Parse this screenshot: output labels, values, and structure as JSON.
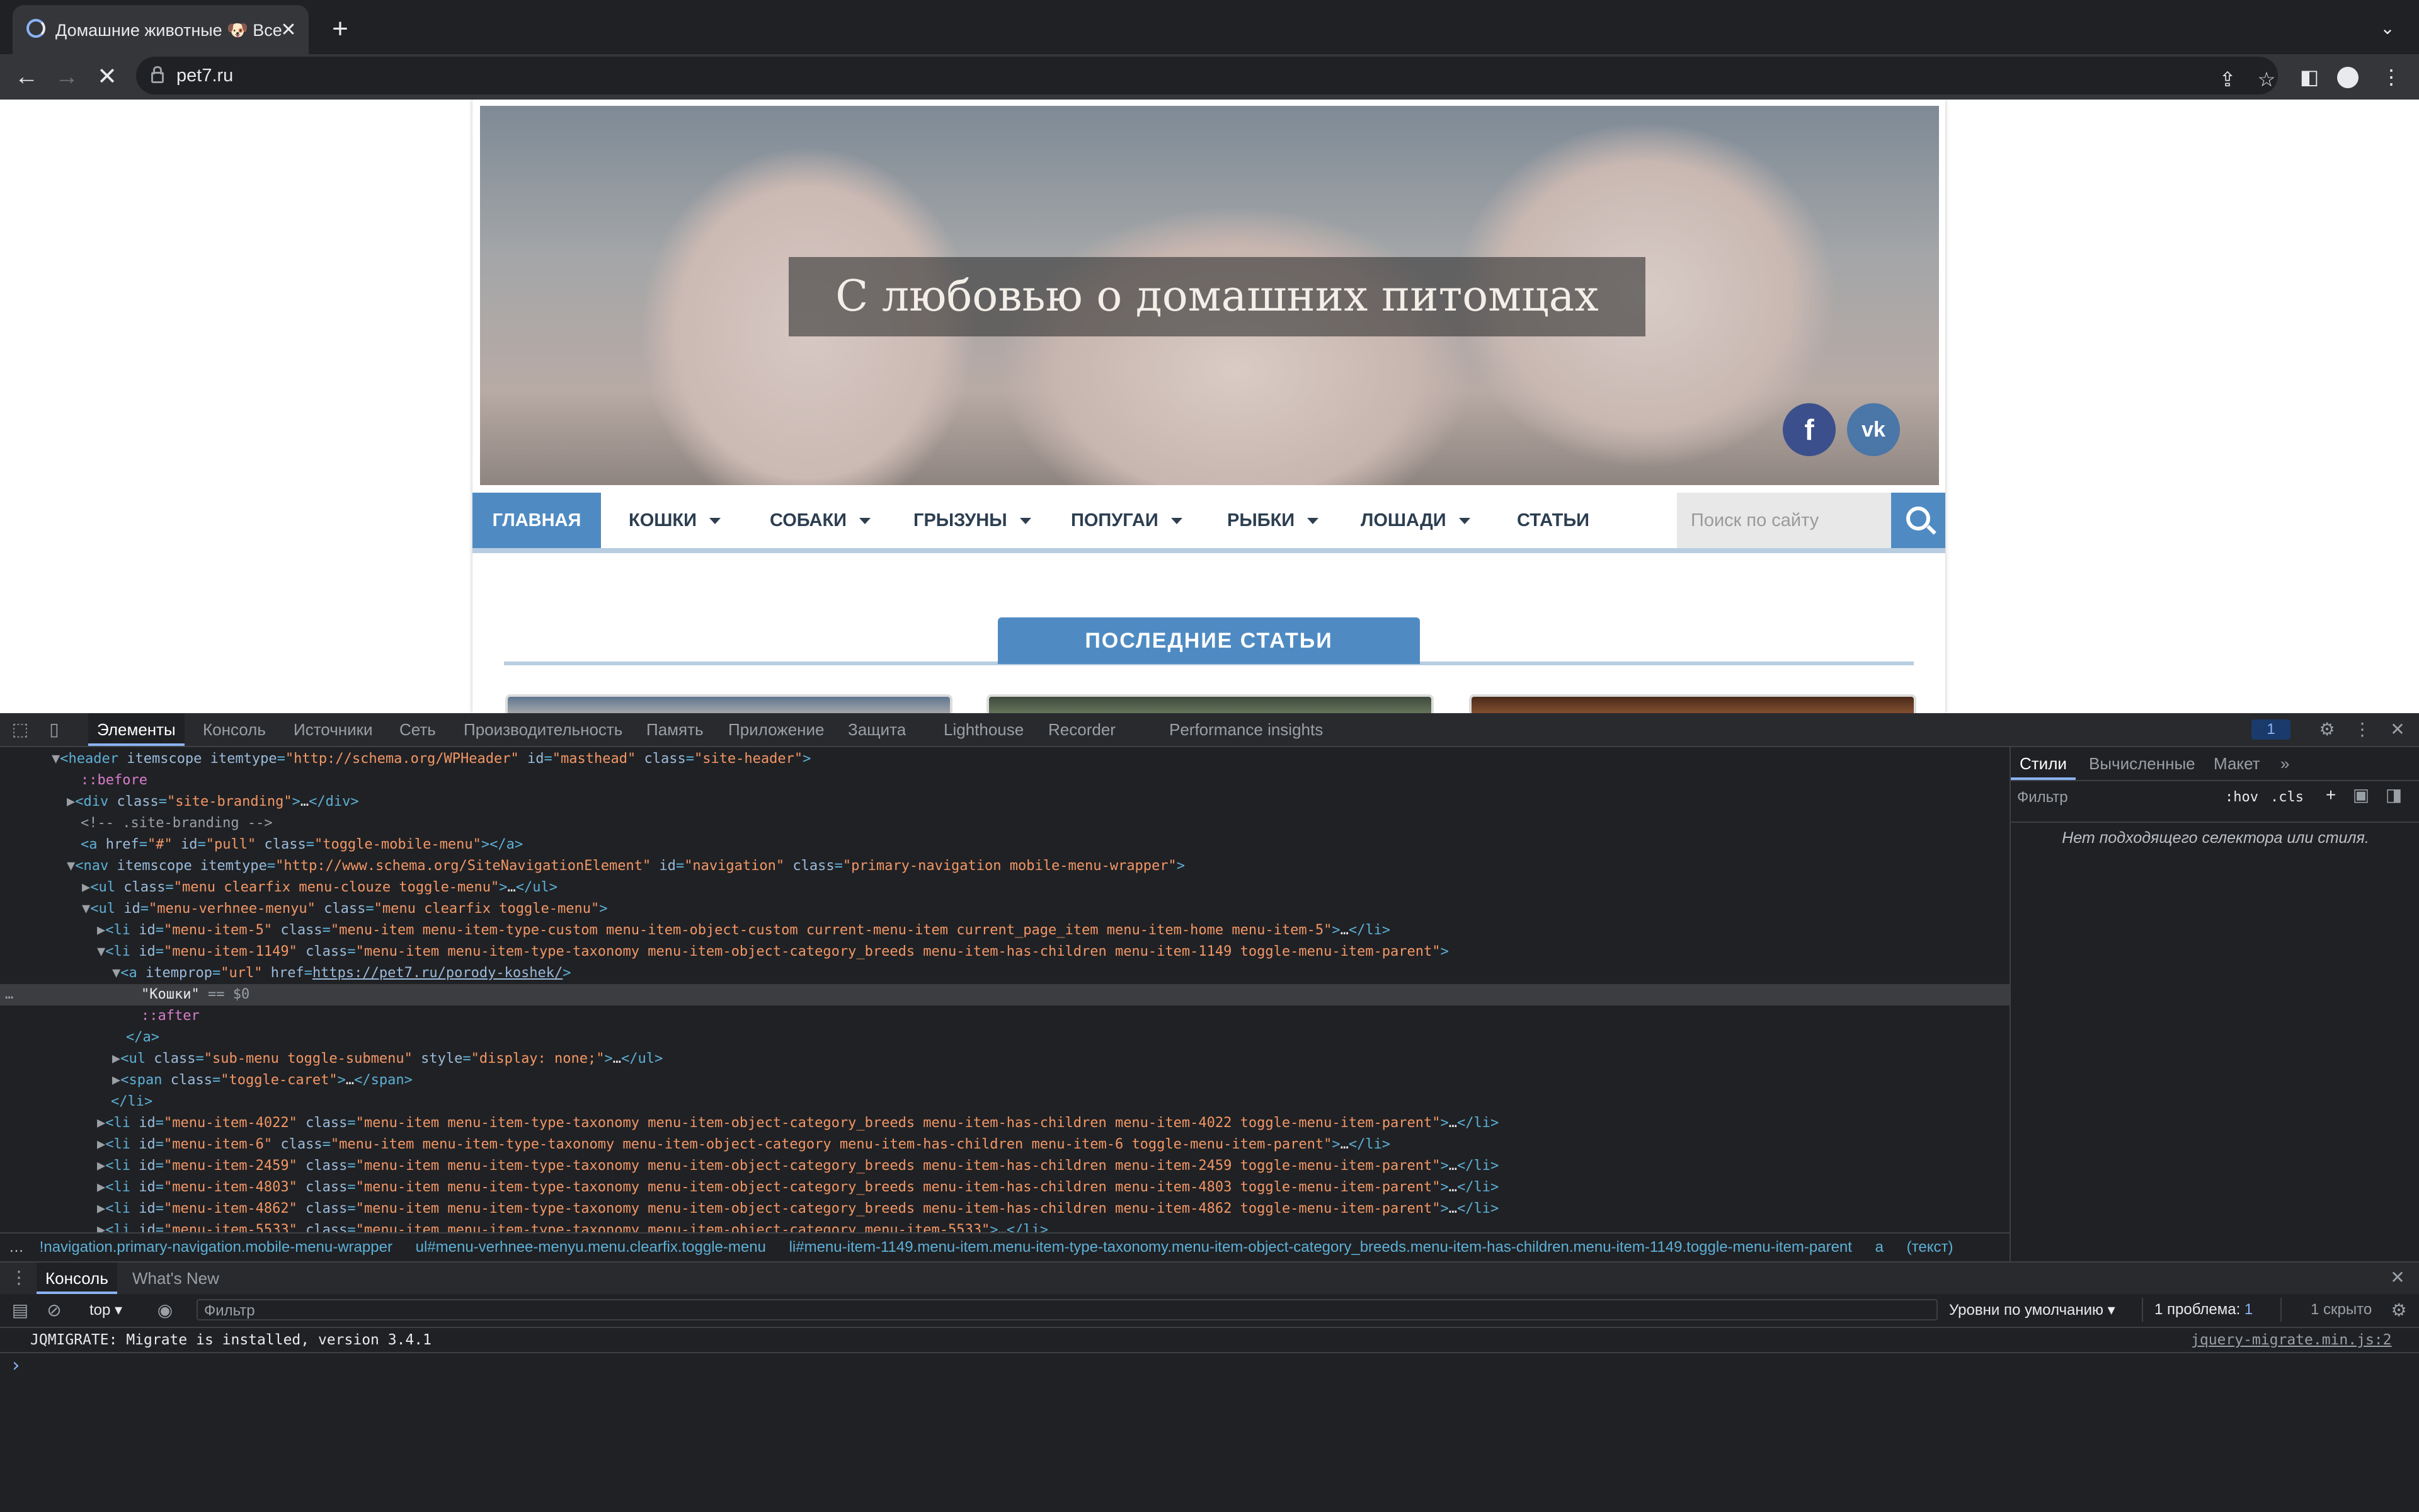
{
  "browser": {
    "tab_title": "Домашние животные 🐶 Все о",
    "close_tab": "✕",
    "new_tab": "+",
    "url": "pet7.ru",
    "back": "←",
    "forward": "→",
    "stop": "✕"
  },
  "site": {
    "hero_title": "С любовью о домашних питомцах",
    "social": {
      "facebook": "f",
      "vk": "vk"
    },
    "nav": {
      "home": "ГЛАВНАЯ",
      "items": [
        "КОШКИ",
        "СОБАКИ",
        "ГРЫЗУНЫ",
        "ПОПУГАИ",
        "РЫБКИ",
        "ЛОШАДИ",
        "СТАТЬИ"
      ]
    },
    "search_placeholder": "Поиск по сайту",
    "latest_heading": "ПОСЛЕДНИЕ СТАТЬИ",
    "colors": {
      "accent": "#4f8bc2",
      "nav_underline": "#b8cde0"
    }
  },
  "devtools": {
    "tabs": [
      "Элементы",
      "Консоль",
      "Источники",
      "Сеть",
      "Производительность",
      "Память",
      "Приложение",
      "Защита",
      "Lighthouse",
      "Recorder",
      "Performance insights"
    ],
    "issues_count": "1",
    "dom_lines": [
      {
        "indent": 0,
        "parts": [
          [
            "tri",
            "▼"
          ],
          [
            "tag",
            "<header "
          ],
          [
            "attr",
            "itemscope itemtype"
          ],
          [
            "tag",
            "="
          ],
          [
            "val",
            "\"http://schema.org/WPHeader\""
          ],
          [
            "attr",
            " id"
          ],
          [
            "tag",
            "="
          ],
          [
            "val",
            "\"masthead\""
          ],
          [
            "attr",
            " class"
          ],
          [
            "tag",
            "="
          ],
          [
            "val",
            "\"site-header\""
          ],
          [
            "tag",
            ">"
          ]
        ]
      },
      {
        "indent": 1,
        "parts": [
          [
            "pseudo",
            "::before"
          ]
        ]
      },
      {
        "indent": 1,
        "parts": [
          [
            "tri",
            "▶"
          ],
          [
            "tag",
            "<div "
          ],
          [
            "attr",
            "class"
          ],
          [
            "tag",
            "="
          ],
          [
            "val",
            "\"site-branding\""
          ],
          [
            "tag",
            ">"
          ],
          [
            "txt",
            "…"
          ],
          [
            "tag",
            "</div>"
          ]
        ]
      },
      {
        "indent": 1,
        "parts": [
          [
            "cmt",
            "<!-- .site-branding -->"
          ]
        ]
      },
      {
        "indent": 1,
        "parts": [
          [
            "tag",
            "<a "
          ],
          [
            "attr",
            "href"
          ],
          [
            "tag",
            "="
          ],
          [
            "val",
            "\"#\""
          ],
          [
            "attr",
            " id"
          ],
          [
            "tag",
            "="
          ],
          [
            "val",
            "\"pull\""
          ],
          [
            "attr",
            " class"
          ],
          [
            "tag",
            "="
          ],
          [
            "val",
            "\"toggle-mobile-menu\""
          ],
          [
            "tag",
            "></a>"
          ]
        ]
      },
      {
        "indent": 1,
        "parts": [
          [
            "tri",
            "▼"
          ],
          [
            "tag",
            "<nav "
          ],
          [
            "attr",
            "itemscope itemtype"
          ],
          [
            "tag",
            "="
          ],
          [
            "val",
            "\"http://www.schema.org/SiteNavigationElement\""
          ],
          [
            "attr",
            " id"
          ],
          [
            "tag",
            "="
          ],
          [
            "val",
            "\"navigation\""
          ],
          [
            "attr",
            " class"
          ],
          [
            "tag",
            "="
          ],
          [
            "val",
            "\"primary-navigation mobile-menu-wrapper\""
          ],
          [
            "tag",
            ">"
          ]
        ]
      },
      {
        "indent": 2,
        "parts": [
          [
            "tri",
            "▶"
          ],
          [
            "tag",
            "<ul "
          ],
          [
            "attr",
            "class"
          ],
          [
            "tag",
            "="
          ],
          [
            "val",
            "\"menu clearfix menu-clouze toggle-menu\""
          ],
          [
            "tag",
            ">"
          ],
          [
            "txt",
            "…"
          ],
          [
            "tag",
            "</ul>"
          ]
        ]
      },
      {
        "indent": 2,
        "parts": [
          [
            "tri",
            "▼"
          ],
          [
            "tag",
            "<ul "
          ],
          [
            "attr",
            "id"
          ],
          [
            "tag",
            "="
          ],
          [
            "val",
            "\"menu-verhnee-menyu\""
          ],
          [
            "attr",
            " class"
          ],
          [
            "tag",
            "="
          ],
          [
            "val",
            "\"menu clearfix toggle-menu\""
          ],
          [
            "tag",
            ">"
          ]
        ]
      },
      {
        "indent": 3,
        "parts": [
          [
            "tri",
            "▶"
          ],
          [
            "tag",
            "<li "
          ],
          [
            "attr",
            "id"
          ],
          [
            "tag",
            "="
          ],
          [
            "val",
            "\"menu-item-5\""
          ],
          [
            "attr",
            " class"
          ],
          [
            "tag",
            "="
          ],
          [
            "val",
            "\"menu-item menu-item-type-custom menu-item-object-custom current-menu-item current_page_item menu-item-home menu-item-5\""
          ],
          [
            "tag",
            ">"
          ],
          [
            "txt",
            "…"
          ],
          [
            "tag",
            "</li>"
          ]
        ]
      },
      {
        "indent": 3,
        "parts": [
          [
            "tri",
            "▼"
          ],
          [
            "tag",
            "<li "
          ],
          [
            "attr",
            "id"
          ],
          [
            "tag",
            "="
          ],
          [
            "val",
            "\"menu-item-1149\""
          ],
          [
            "attr",
            " class"
          ],
          [
            "tag",
            "="
          ],
          [
            "val",
            "\"menu-item menu-item-type-taxonomy menu-item-object-category_breeds menu-item-has-children menu-item-1149 toggle-menu-item-parent\""
          ],
          [
            "tag",
            ">"
          ]
        ]
      },
      {
        "indent": 4,
        "parts": [
          [
            "tri",
            "▼"
          ],
          [
            "tag",
            "<a "
          ],
          [
            "attr",
            "itemprop"
          ],
          [
            "tag",
            "="
          ],
          [
            "val",
            "\"url\""
          ],
          [
            "attr",
            " href"
          ],
          [
            "tag",
            "="
          ],
          [
            "link",
            "https://pet7.ru/porody-koshek/"
          ],
          [
            "tag",
            ">"
          ]
        ]
      },
      {
        "indent": 5,
        "sel": true,
        "parts": [
          [
            "txt",
            "\"Кошки\""
          ],
          [
            "cmt",
            " == $0"
          ]
        ]
      },
      {
        "indent": 5,
        "parts": [
          [
            "pseudo",
            "::after"
          ]
        ]
      },
      {
        "indent": 4,
        "parts": [
          [
            "tag",
            "</a>"
          ]
        ]
      },
      {
        "indent": 4,
        "parts": [
          [
            "tri",
            "▶"
          ],
          [
            "tag",
            "<ul "
          ],
          [
            "attr",
            "class"
          ],
          [
            "tag",
            "="
          ],
          [
            "val",
            "\"sub-menu toggle-submenu\""
          ],
          [
            "attr",
            " style"
          ],
          [
            "tag",
            "="
          ],
          [
            "val",
            "\"display: none;\""
          ],
          [
            "tag",
            ">"
          ],
          [
            "txt",
            "…"
          ],
          [
            "tag",
            "</ul>"
          ]
        ]
      },
      {
        "indent": 4,
        "parts": [
          [
            "tri",
            "▶"
          ],
          [
            "tag",
            "<span "
          ],
          [
            "attr",
            "class"
          ],
          [
            "tag",
            "="
          ],
          [
            "val",
            "\"toggle-caret\""
          ],
          [
            "tag",
            ">"
          ],
          [
            "txt",
            "…"
          ],
          [
            "tag",
            "</span>"
          ]
        ]
      },
      {
        "indent": 3,
        "parts": [
          [
            "tag",
            "</li>"
          ]
        ]
      },
      {
        "indent": 3,
        "parts": [
          [
            "tri",
            "▶"
          ],
          [
            "tag",
            "<li "
          ],
          [
            "attr",
            "id"
          ],
          [
            "tag",
            "="
          ],
          [
            "val",
            "\"menu-item-4022\""
          ],
          [
            "attr",
            " class"
          ],
          [
            "tag",
            "="
          ],
          [
            "val",
            "\"menu-item menu-item-type-taxonomy menu-item-object-category_breeds menu-item-has-children menu-item-4022 toggle-menu-item-parent\""
          ],
          [
            "tag",
            ">"
          ],
          [
            "txt",
            "…"
          ],
          [
            "tag",
            "</li>"
          ]
        ]
      },
      {
        "indent": 3,
        "parts": [
          [
            "tri",
            "▶"
          ],
          [
            "tag",
            "<li "
          ],
          [
            "attr",
            "id"
          ],
          [
            "tag",
            "="
          ],
          [
            "val",
            "\"menu-item-6\""
          ],
          [
            "attr",
            " class"
          ],
          [
            "tag",
            "="
          ],
          [
            "val",
            "\"menu-item menu-item-type-taxonomy menu-item-object-category menu-item-has-children menu-item-6 toggle-menu-item-parent\""
          ],
          [
            "tag",
            ">"
          ],
          [
            "txt",
            "…"
          ],
          [
            "tag",
            "</li>"
          ]
        ]
      },
      {
        "indent": 3,
        "parts": [
          [
            "tri",
            "▶"
          ],
          [
            "tag",
            "<li "
          ],
          [
            "attr",
            "id"
          ],
          [
            "tag",
            "="
          ],
          [
            "val",
            "\"menu-item-2459\""
          ],
          [
            "attr",
            " class"
          ],
          [
            "tag",
            "="
          ],
          [
            "val",
            "\"menu-item menu-item-type-taxonomy menu-item-object-category_breeds menu-item-has-children menu-item-2459 toggle-menu-item-parent\""
          ],
          [
            "tag",
            ">"
          ],
          [
            "txt",
            "…"
          ],
          [
            "tag",
            "</li>"
          ]
        ]
      },
      {
        "indent": 3,
        "parts": [
          [
            "tri",
            "▶"
          ],
          [
            "tag",
            "<li "
          ],
          [
            "attr",
            "id"
          ],
          [
            "tag",
            "="
          ],
          [
            "val",
            "\"menu-item-4803\""
          ],
          [
            "attr",
            " class"
          ],
          [
            "tag",
            "="
          ],
          [
            "val",
            "\"menu-item menu-item-type-taxonomy menu-item-object-category_breeds menu-item-has-children menu-item-4803 toggle-menu-item-parent\""
          ],
          [
            "tag",
            ">"
          ],
          [
            "txt",
            "…"
          ],
          [
            "tag",
            "</li>"
          ]
        ]
      },
      {
        "indent": 3,
        "parts": [
          [
            "tri",
            "▶"
          ],
          [
            "tag",
            "<li "
          ],
          [
            "attr",
            "id"
          ],
          [
            "tag",
            "="
          ],
          [
            "val",
            "\"menu-item-4862\""
          ],
          [
            "attr",
            " class"
          ],
          [
            "tag",
            "="
          ],
          [
            "val",
            "\"menu-item menu-item-type-taxonomy menu-item-object-category_breeds menu-item-has-children menu-item-4862 toggle-menu-item-parent\""
          ],
          [
            "tag",
            ">"
          ],
          [
            "txt",
            "…"
          ],
          [
            "tag",
            "</li>"
          ]
        ]
      },
      {
        "indent": 3,
        "parts": [
          [
            "tri",
            "▶"
          ],
          [
            "tag",
            "<li "
          ],
          [
            "attr",
            "id"
          ],
          [
            "tag",
            "="
          ],
          [
            "val",
            "\"menu-item-5533\""
          ],
          [
            "attr",
            " class"
          ],
          [
            "tag",
            "="
          ],
          [
            "val",
            "\"menu-item menu-item-type-taxonomy menu-item-object-category menu-item-5533\""
          ],
          [
            "tag",
            ">"
          ],
          [
            "txt",
            "…"
          ],
          [
            "tag",
            "</li>"
          ]
        ]
      }
    ],
    "breadcrumb": [
      "!navigation.primary-navigation.mobile-menu-wrapper",
      "ul#menu-verhnee-menyu.menu.clearfix.toggle-menu",
      "li#menu-item-1149.menu-item.menu-item-type-taxonomy.menu-item-object-category_breeds.menu-item-has-children.menu-item-1149.toggle-menu-item-parent",
      "a",
      "(текст)"
    ],
    "styles": {
      "tabs": [
        "Стили",
        "Вычисленные",
        "Макет"
      ],
      "filter_placeholder": "Фильтр",
      "hov": ":hov",
      "cls": ".cls",
      "empty_message": "Нет подходящего селектора или стиля."
    },
    "drawer": {
      "tabs": [
        "Консоль",
        "What's New"
      ],
      "context": "top",
      "filter_placeholder": "Фильтр",
      "levels": "Уровни по умолчанию",
      "issues_label": "1 проблема:",
      "issues_count": "1",
      "hidden": "1 скрыто",
      "message": "JQMIGRATE: Migrate is installed, version 3.4.1",
      "source": "jquery-migrate.min.js:2",
      "prompt": "›"
    }
  }
}
